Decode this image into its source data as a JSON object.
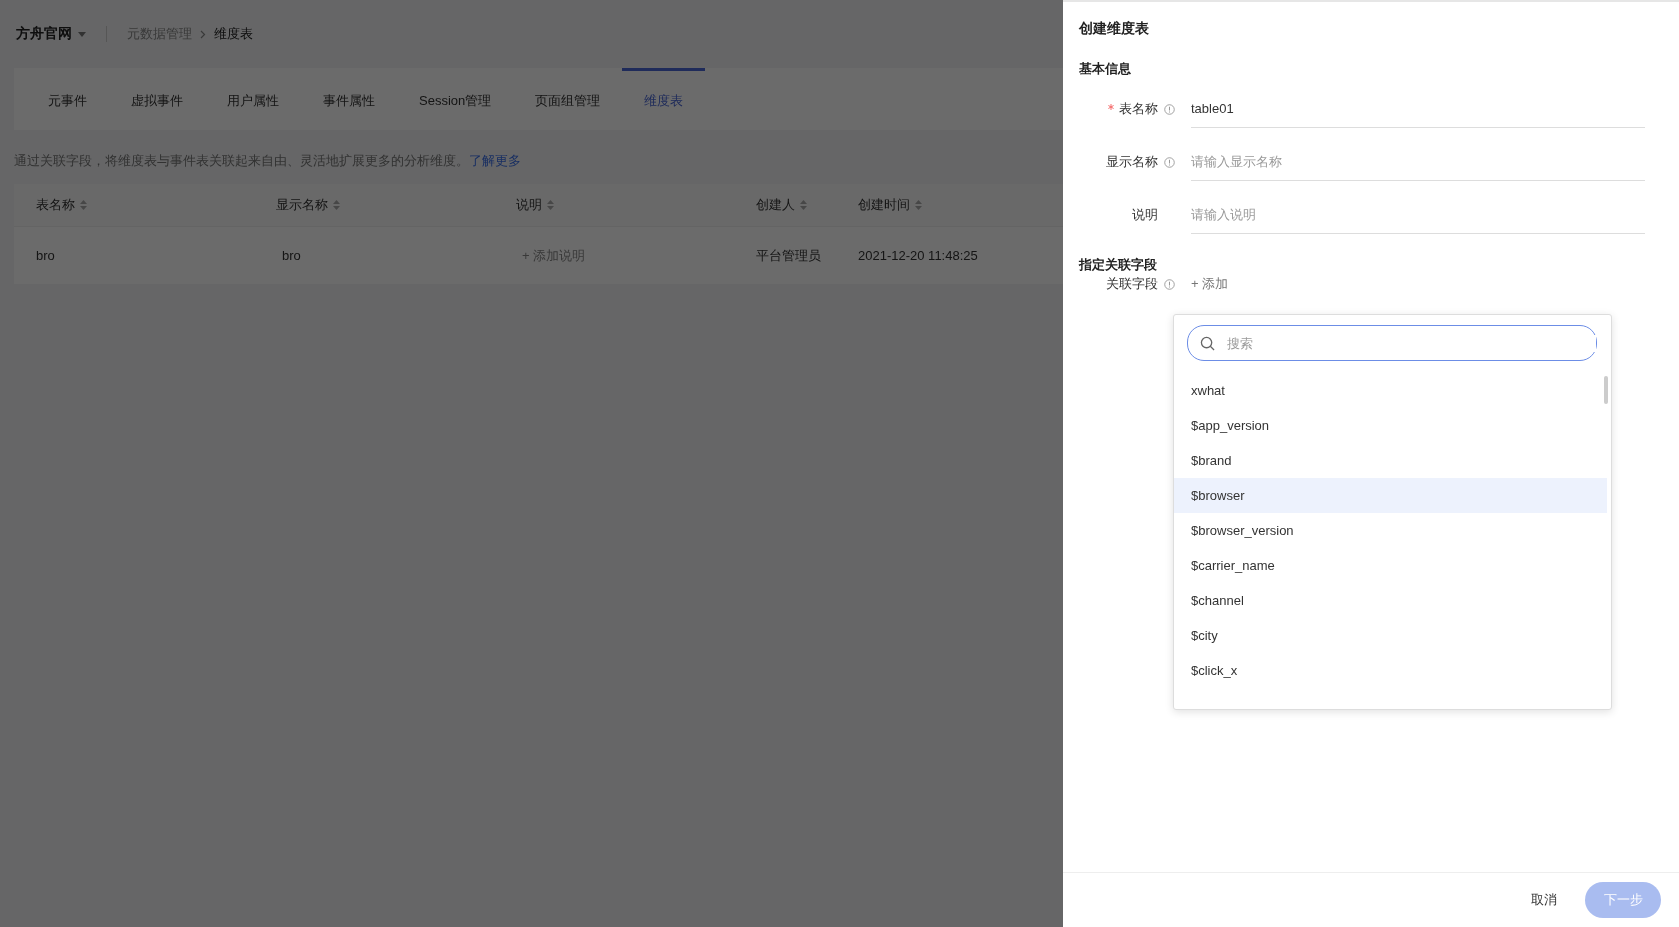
{
  "header": {
    "project": "方舟官网",
    "breadcrumb": [
      {
        "label": "元数据管理",
        "current": false
      },
      {
        "label": "维度表",
        "current": true
      }
    ]
  },
  "tabs": [
    {
      "label": "元事件",
      "selected": false
    },
    {
      "label": "虚拟事件",
      "selected": false
    },
    {
      "label": "用户属性",
      "selected": false
    },
    {
      "label": "事件属性",
      "selected": false
    },
    {
      "label": "Session管理",
      "selected": false
    },
    {
      "label": "页面组管理",
      "selected": false
    },
    {
      "label": "维度表",
      "selected": true
    }
  ],
  "description": {
    "text": "通过关联字段，将维度表与事件表关联起来自由、灵活地扩展更多的分析维度。",
    "link": "了解更多"
  },
  "table": {
    "columns": [
      "表名称",
      "显示名称",
      "说明",
      "创建人",
      "创建时间"
    ],
    "rows": [
      {
        "name": "bro",
        "display_name": "bro",
        "note_action": "+ 添加说明",
        "creator": "平台管理员",
        "created": "2021-12-20 11:48:25"
      }
    ]
  },
  "drawer": {
    "title": "创建维度表",
    "sections": [
      {
        "heading": "基本信息",
        "fields": [
          {
            "label": "表名称",
            "required": true,
            "info": true,
            "value": "table01"
          },
          {
            "label": "显示名称",
            "info": true,
            "placeholder": "请输入显示名称"
          },
          {
            "label": "说明",
            "placeholder": "请输入说明"
          }
        ]
      },
      {
        "heading": "指定关联字段",
        "fields": [
          {
            "label": "关联字段",
            "info": true,
            "add": "+ 添加"
          }
        ]
      }
    ],
    "dropdown": {
      "search_placeholder": "搜索",
      "options": [
        {
          "label": "xwhat",
          "selected": false
        },
        {
          "label": "$app_version",
          "selected": false
        },
        {
          "label": "$brand",
          "selected": false
        },
        {
          "label": "$browser",
          "selected": true
        },
        {
          "label": "$browser_version",
          "selected": false
        },
        {
          "label": "$carrier_name",
          "selected": false
        },
        {
          "label": "$channel",
          "selected": false
        },
        {
          "label": "$city",
          "selected": false
        },
        {
          "label": "$click_x",
          "selected": false
        }
      ]
    },
    "buttons": {
      "cancel": "取消",
      "next": "下一步",
      "next_disabled": true
    }
  }
}
